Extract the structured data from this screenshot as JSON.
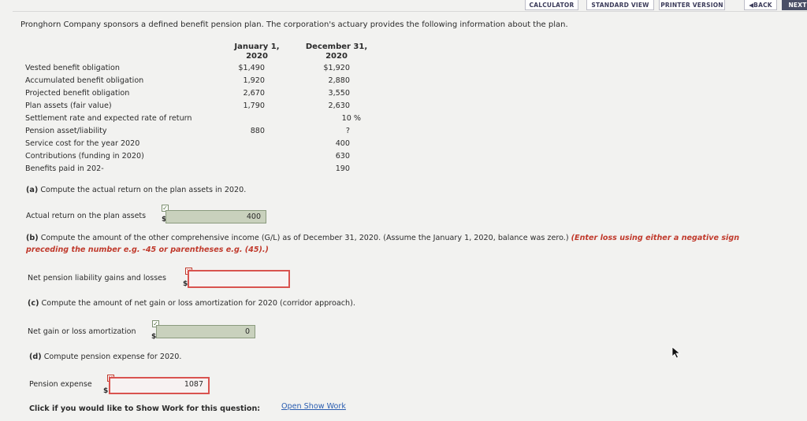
{
  "toolbar": {
    "calculator": "CALCULATOR",
    "standard_view": "STANDARD VIEW",
    "printer_version": "PRINTER VERSION",
    "back": "BACK",
    "next": "NEXT"
  },
  "intro": "Pronghorn Company sponsors a defined benefit pension plan. The corporation's actuary provides the following information about the plan.",
  "columns": {
    "jan_line1": "January 1,",
    "jan_line2": "2020",
    "dec_line1": "December 31,",
    "dec_line2": "2020"
  },
  "rows": [
    {
      "label": "Vested benefit obligation",
      "jan": "$1,490",
      "dec": "$1,920"
    },
    {
      "label": "Accumulated benefit obligation",
      "jan": "1,920",
      "dec": "2,880"
    },
    {
      "label": "Projected benefit obligation",
      "jan": "2,670",
      "dec": "3,550"
    },
    {
      "label": "Plan assets (fair value)",
      "jan": "1,790",
      "dec": "2,630"
    },
    {
      "label": "Settlement rate and expected rate of return",
      "jan": "",
      "dec": "10 %"
    },
    {
      "label": "Pension asset/liability",
      "jan": "880",
      "dec": "?"
    },
    {
      "label": "Service cost for the year 2020",
      "jan": "",
      "dec": "400"
    },
    {
      "label": "Contributions (funding in 2020)",
      "jan": "",
      "dec": "630"
    },
    {
      "label": "Benefits paid in 202-",
      "jan": "",
      "dec": "190"
    }
  ],
  "part_a": {
    "prefix": "(a)",
    "question": "Compute the actual return on the plan assets in 2020.",
    "field_label": "Actual return on the plan assets",
    "currency": "$",
    "value": "400",
    "status": "correct"
  },
  "part_b": {
    "prefix": "(b)",
    "question": "Compute the amount of the other comprehensive income (G/L) as of December 31, 2020. (Assume the January 1, 2020, balance was zero.)",
    "hint": "(Enter loss using either a negative sign preceding the number e.g. -45 or parentheses e.g. (45).)",
    "hint_line1": "(Enter loss using either a negative sign",
    "hint_line2": "preceding the number e.g. -45 or parentheses e.g. (45).)",
    "field_label": "Net pension liability gains and losses",
    "currency": "$",
    "value": "",
    "status": "incorrect"
  },
  "part_c": {
    "prefix": "(c)",
    "question": "Compute the amount of net gain or loss amortization for 2020 (corridor approach).",
    "field_label": "Net gain or loss amortization",
    "currency": "$",
    "value": "0",
    "status": "correct"
  },
  "part_d": {
    "prefix": "(d)",
    "question": "Compute pension expense for 2020.",
    "field_label": "Pension expense",
    "currency": "$",
    "value": "1087",
    "status": "incorrect"
  },
  "footer": {
    "prompt": "Click if you would like to Show Work for this question:",
    "link": "Open Show Work"
  },
  "icons": {
    "correct": "check-icon",
    "incorrect": "x-icon"
  },
  "colors": {
    "correct_fill": "#c9d1bd",
    "incorrect_border": "#d9534f",
    "hint_red": "#c0392b",
    "link_blue": "#2a5db0"
  }
}
